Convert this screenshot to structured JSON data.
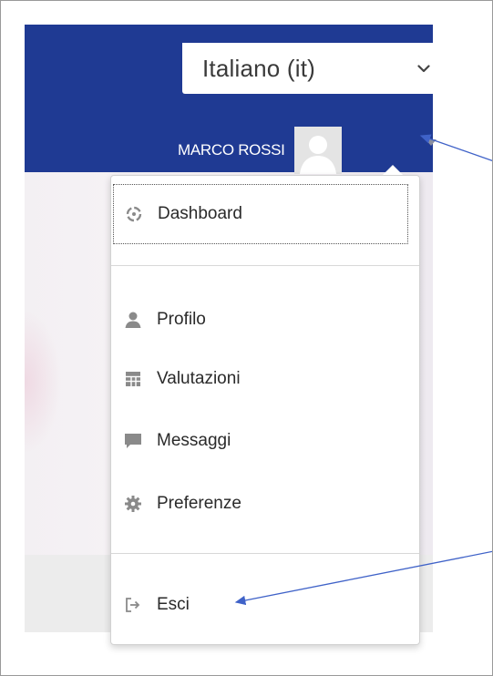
{
  "language_selector": {
    "selected": "Italiano (it)"
  },
  "user": {
    "name": "MARCO ROSSI"
  },
  "menu": {
    "items": [
      {
        "id": "dashboard",
        "label": "Dashboard",
        "icon": "dashboard-icon"
      },
      {
        "id": "profilo",
        "label": "Profilo",
        "icon": "user-icon"
      },
      {
        "id": "valutazioni",
        "label": "Valutazioni",
        "icon": "grades-table-icon"
      },
      {
        "id": "messaggi",
        "label": "Messaggi",
        "icon": "message-icon"
      },
      {
        "id": "preferenze",
        "label": "Preferenze",
        "icon": "gear-icon"
      },
      {
        "id": "esci",
        "label": "Esci",
        "icon": "logout-icon"
      }
    ]
  },
  "colors": {
    "navbar": "#1f3a93",
    "annotation_arrow": "#3f62c8",
    "icon": "#8a8a8a"
  }
}
